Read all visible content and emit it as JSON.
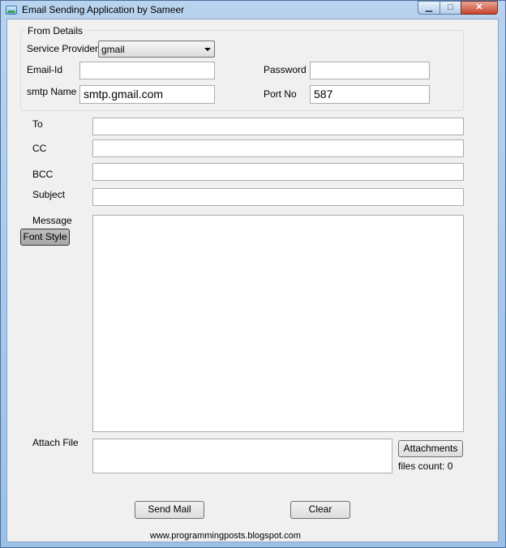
{
  "window": {
    "title": "Email Sending Application by Sameer",
    "minimize_glyph": "▁",
    "maximize_glyph": "□",
    "close_glyph": "✕"
  },
  "from_details": {
    "legend": "From Details",
    "service_provider_label": "Service Provider",
    "service_provider_value": "gmail",
    "email_id_label": "Email-Id",
    "email_id_value": "",
    "password_label": "Password",
    "password_value": "",
    "smtp_name_label": "smtp Name",
    "smtp_name_value": "smtp.gmail.com",
    "port_no_label": "Port No",
    "port_no_value": "587"
  },
  "message_fields": {
    "to_label": "To",
    "to_value": "",
    "cc_label": "CC",
    "cc_value": "",
    "bcc_label": "BCC",
    "bcc_value": "",
    "subject_label": "Subject",
    "subject_value": "",
    "message_label": "Message",
    "message_value": "",
    "font_style_label": "Font Style"
  },
  "attachments": {
    "attach_file_label": "Attach File",
    "attachments_button_label": "Attachments",
    "files_count_text": "files count: 0"
  },
  "actions": {
    "send_mail_label": "Send Mail",
    "clear_label": "Clear"
  },
  "footer": {
    "text": "www.programmingposts.blogspot.com"
  }
}
